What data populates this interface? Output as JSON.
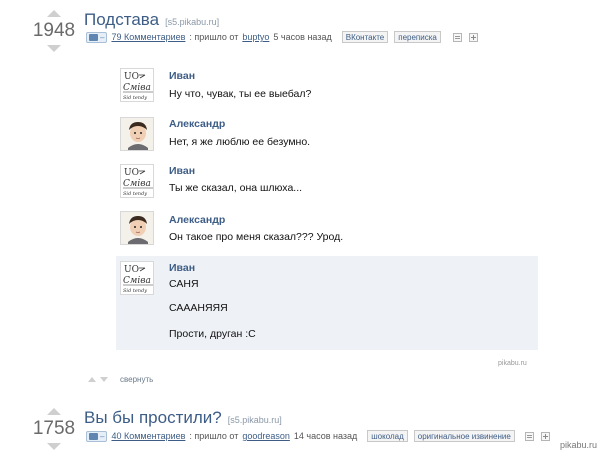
{
  "posts": [
    {
      "score": "1948",
      "title": "Подстава",
      "domain": "[s5.pikabu.ru]",
      "badge_dash": "–",
      "comments": "79 Комментариев",
      "meta_text": ": пришло от",
      "author": "buptyo",
      "time": "5 часов назад",
      "tags": [
        "ВКонтакте",
        "переписка"
      ]
    },
    {
      "score": "1758",
      "title": "Вы бы простили?",
      "domain": "[s5.pikabu.ru]",
      "badge_dash": "–",
      "comments": "40 Комментариев",
      "meta_text": ": пришло от",
      "author": "goodreason",
      "time": "14 часов назад",
      "tags": [
        "шоколад",
        "оригинальное извинение"
      ]
    }
  ],
  "chat": [
    {
      "name": "Иван",
      "lines": [
        "Ну что, чувак, ты ее выебал?"
      ],
      "avatar": "ivan-avatar"
    },
    {
      "name": "Александр",
      "lines": [
        "Нет, я же люблю ее безумно."
      ],
      "avatar": "alexander-avatar"
    },
    {
      "name": "Иван",
      "lines": [
        "Ты же сказал, она шлюха..."
      ],
      "avatar": "ivan-avatar"
    },
    {
      "name": "Александр",
      "lines": [
        "Он такое про меня сказал??? Урод."
      ],
      "avatar": "alexander-avatar"
    },
    {
      "name": "Иван",
      "lines": [
        "САНЯ",
        "САААНЯЯЯ",
        "Прости, друган :С"
      ],
      "avatar": "ivan-avatar"
    }
  ],
  "collapse_label": "свернуть",
  "watermark_small": "pikabu.ru",
  "watermark_big": "pikabu.ru",
  "colors": {
    "link": "#3d5d86",
    "highlight": "#eef1f5"
  }
}
